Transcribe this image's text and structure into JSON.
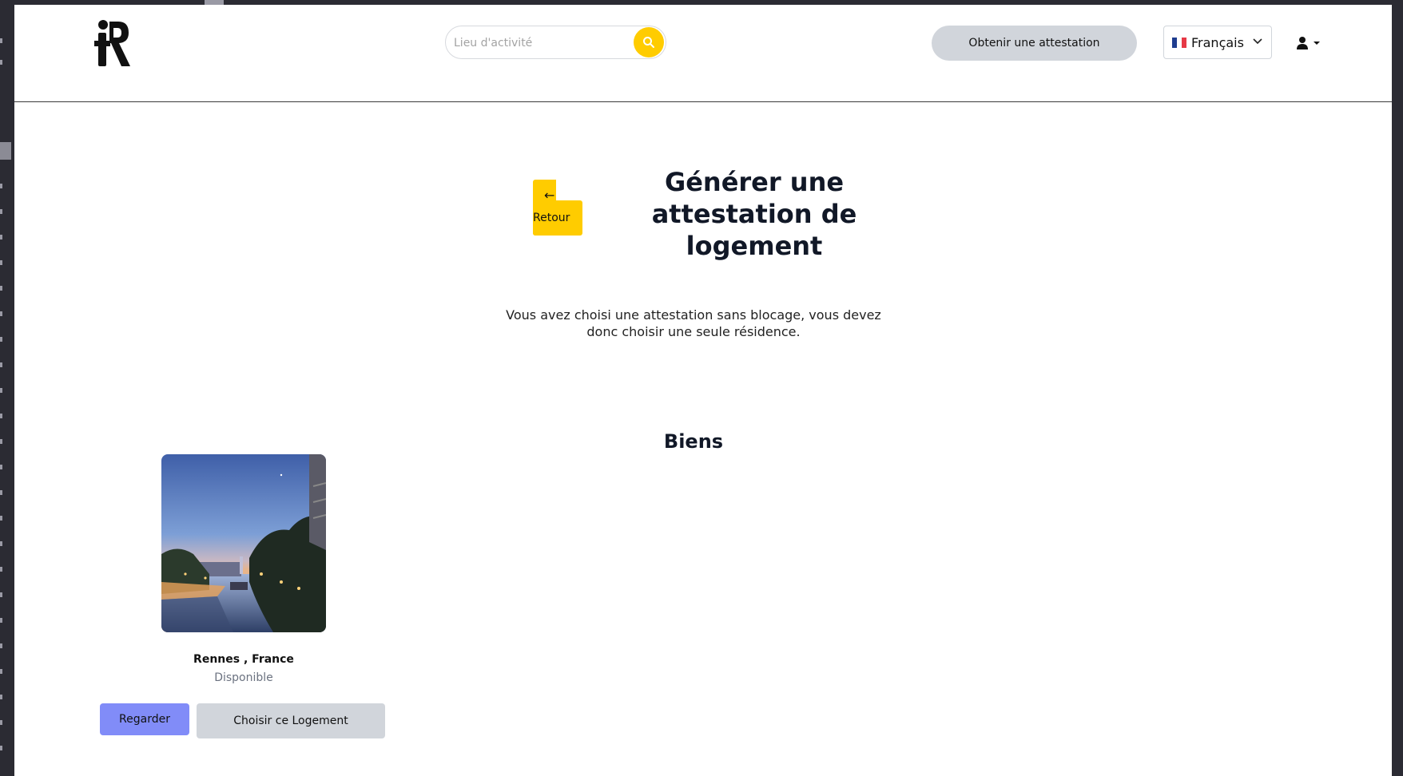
{
  "header": {
    "search": {
      "placeholder": "Lieu d'activité"
    },
    "attestation_button": "Obtenir une attestation",
    "language": {
      "label": "Français",
      "flag_colors": [
        "#1f3d8f",
        "#ffffff",
        "#e63946"
      ]
    }
  },
  "main": {
    "back_label": "Retour",
    "title": "Générer une attestation de logement",
    "subtitle": "Vous avez choisi une attestation sans blocage, vous devez donc choisir une seule résidence.",
    "section_title": "Biens",
    "property": {
      "city": "Rennes , France",
      "status": "Disponible",
      "view_button": "Regarder",
      "choose_button": "Choisir ce Logement"
    }
  },
  "colors": {
    "accent_yellow": "#ffcc00",
    "primary_purple": "#818cf8",
    "neutral_button": "#d1d5db"
  }
}
